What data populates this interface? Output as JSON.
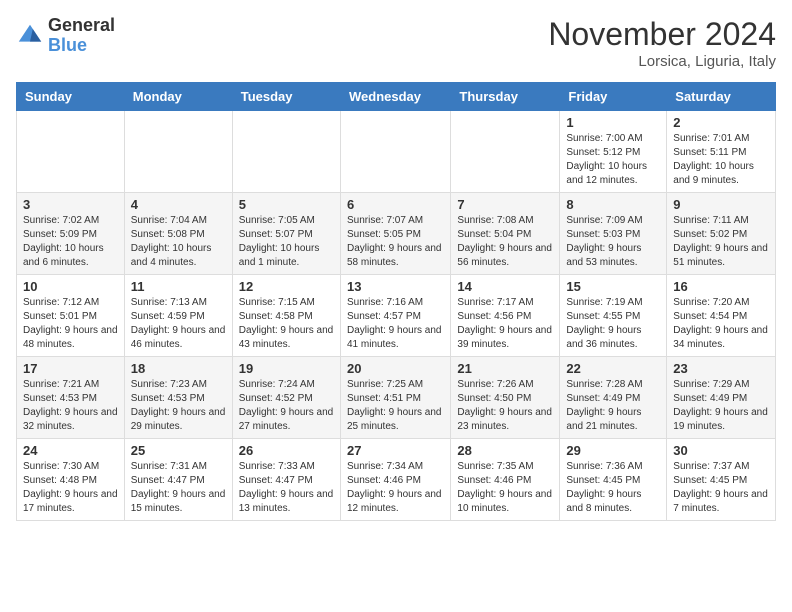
{
  "logo": {
    "text_general": "General",
    "text_blue": "Blue"
  },
  "header": {
    "title": "November 2024",
    "subtitle": "Lorsica, Liguria, Italy"
  },
  "weekdays": [
    "Sunday",
    "Monday",
    "Tuesday",
    "Wednesday",
    "Thursday",
    "Friday",
    "Saturday"
  ],
  "weeks": [
    [
      {
        "day": "",
        "info": ""
      },
      {
        "day": "",
        "info": ""
      },
      {
        "day": "",
        "info": ""
      },
      {
        "day": "",
        "info": ""
      },
      {
        "day": "",
        "info": ""
      },
      {
        "day": "1",
        "info": "Sunrise: 7:00 AM\nSunset: 5:12 PM\nDaylight: 10 hours and 12 minutes."
      },
      {
        "day": "2",
        "info": "Sunrise: 7:01 AM\nSunset: 5:11 PM\nDaylight: 10 hours and 9 minutes."
      }
    ],
    [
      {
        "day": "3",
        "info": "Sunrise: 7:02 AM\nSunset: 5:09 PM\nDaylight: 10 hours and 6 minutes."
      },
      {
        "day": "4",
        "info": "Sunrise: 7:04 AM\nSunset: 5:08 PM\nDaylight: 10 hours and 4 minutes."
      },
      {
        "day": "5",
        "info": "Sunrise: 7:05 AM\nSunset: 5:07 PM\nDaylight: 10 hours and 1 minute."
      },
      {
        "day": "6",
        "info": "Sunrise: 7:07 AM\nSunset: 5:05 PM\nDaylight: 9 hours and 58 minutes."
      },
      {
        "day": "7",
        "info": "Sunrise: 7:08 AM\nSunset: 5:04 PM\nDaylight: 9 hours and 56 minutes."
      },
      {
        "day": "8",
        "info": "Sunrise: 7:09 AM\nSunset: 5:03 PM\nDaylight: 9 hours and 53 minutes."
      },
      {
        "day": "9",
        "info": "Sunrise: 7:11 AM\nSunset: 5:02 PM\nDaylight: 9 hours and 51 minutes."
      }
    ],
    [
      {
        "day": "10",
        "info": "Sunrise: 7:12 AM\nSunset: 5:01 PM\nDaylight: 9 hours and 48 minutes."
      },
      {
        "day": "11",
        "info": "Sunrise: 7:13 AM\nSunset: 4:59 PM\nDaylight: 9 hours and 46 minutes."
      },
      {
        "day": "12",
        "info": "Sunrise: 7:15 AM\nSunset: 4:58 PM\nDaylight: 9 hours and 43 minutes."
      },
      {
        "day": "13",
        "info": "Sunrise: 7:16 AM\nSunset: 4:57 PM\nDaylight: 9 hours and 41 minutes."
      },
      {
        "day": "14",
        "info": "Sunrise: 7:17 AM\nSunset: 4:56 PM\nDaylight: 9 hours and 39 minutes."
      },
      {
        "day": "15",
        "info": "Sunrise: 7:19 AM\nSunset: 4:55 PM\nDaylight: 9 hours and 36 minutes."
      },
      {
        "day": "16",
        "info": "Sunrise: 7:20 AM\nSunset: 4:54 PM\nDaylight: 9 hours and 34 minutes."
      }
    ],
    [
      {
        "day": "17",
        "info": "Sunrise: 7:21 AM\nSunset: 4:53 PM\nDaylight: 9 hours and 32 minutes."
      },
      {
        "day": "18",
        "info": "Sunrise: 7:23 AM\nSunset: 4:53 PM\nDaylight: 9 hours and 29 minutes."
      },
      {
        "day": "19",
        "info": "Sunrise: 7:24 AM\nSunset: 4:52 PM\nDaylight: 9 hours and 27 minutes."
      },
      {
        "day": "20",
        "info": "Sunrise: 7:25 AM\nSunset: 4:51 PM\nDaylight: 9 hours and 25 minutes."
      },
      {
        "day": "21",
        "info": "Sunrise: 7:26 AM\nSunset: 4:50 PM\nDaylight: 9 hours and 23 minutes."
      },
      {
        "day": "22",
        "info": "Sunrise: 7:28 AM\nSunset: 4:49 PM\nDaylight: 9 hours and 21 minutes."
      },
      {
        "day": "23",
        "info": "Sunrise: 7:29 AM\nSunset: 4:49 PM\nDaylight: 9 hours and 19 minutes."
      }
    ],
    [
      {
        "day": "24",
        "info": "Sunrise: 7:30 AM\nSunset: 4:48 PM\nDaylight: 9 hours and 17 minutes."
      },
      {
        "day": "25",
        "info": "Sunrise: 7:31 AM\nSunset: 4:47 PM\nDaylight: 9 hours and 15 minutes."
      },
      {
        "day": "26",
        "info": "Sunrise: 7:33 AM\nSunset: 4:47 PM\nDaylight: 9 hours and 13 minutes."
      },
      {
        "day": "27",
        "info": "Sunrise: 7:34 AM\nSunset: 4:46 PM\nDaylight: 9 hours and 12 minutes."
      },
      {
        "day": "28",
        "info": "Sunrise: 7:35 AM\nSunset: 4:46 PM\nDaylight: 9 hours and 10 minutes."
      },
      {
        "day": "29",
        "info": "Sunrise: 7:36 AM\nSunset: 4:45 PM\nDaylight: 9 hours and 8 minutes."
      },
      {
        "day": "30",
        "info": "Sunrise: 7:37 AM\nSunset: 4:45 PM\nDaylight: 9 hours and 7 minutes."
      }
    ]
  ]
}
